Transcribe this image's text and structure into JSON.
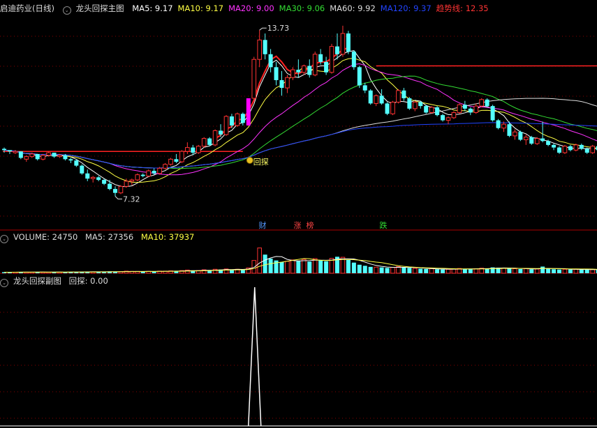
{
  "main_header": {
    "stock": "启迪药业(日线)",
    "indicator": "龙头回探主图",
    "items": [
      {
        "label": "MA5: 9.17",
        "color": "#ffffff"
      },
      {
        "label": "MA10: 9.17",
        "color": "#ffff44"
      },
      {
        "label": "MA20: 9.00",
        "color": "#ff33ff"
      },
      {
        "label": "MA30: 9.06",
        "color": "#33dd33"
      },
      {
        "label": "MA60: 9.92",
        "color": "#dddddd"
      },
      {
        "label": "MA120: 9.37",
        "color": "#2244ff"
      },
      {
        "label": "趋势线: 12.35",
        "color": "#ff3333"
      }
    ]
  },
  "volume_header": {
    "title": "VOLUME: 24750",
    "ma5": "MA5: 27356",
    "ma10": "MA10: 37937"
  },
  "sub_header": {
    "title": "龙头回探副图",
    "value": "回探: 0.00"
  },
  "annotations": {
    "high": "13.73",
    "low": "7.32",
    "signal": "回探",
    "tags": [
      {
        "text": "财",
        "color": "#5599ff"
      },
      {
        "text": "涨",
        "color": "#ff4444"
      },
      {
        "text": "榜",
        "color": "#ff4444"
      },
      {
        "text": "跌",
        "color": "#33dd33"
      }
    ]
  },
  "colors": {
    "up": "#ff3333",
    "down": "#54ffff",
    "volume_up": "#ff3333",
    "volume_down": "#54ffff",
    "grid": "#8a0000",
    "divider": "#aa0000",
    "limit_up_bar": "#ff00ff",
    "trend_line": "#ff2222"
  },
  "chart_data": {
    "type": "candlestick",
    "price_range": [
      6.5,
      14.3
    ],
    "trend_levels": [
      9.05,
      12.35
    ],
    "candles": [
      [
        9.15,
        9.2,
        9.0,
        9.1
      ],
      [
        9.1,
        9.1,
        8.95,
        9.05
      ],
      [
        9.0,
        9.1,
        8.95,
        9.05
      ],
      [
        9.05,
        9.05,
        8.75,
        8.8
      ],
      [
        8.75,
        8.9,
        8.65,
        8.85
      ],
      [
        8.85,
        9.0,
        8.8,
        8.95
      ],
      [
        8.95,
        8.95,
        8.7,
        8.75
      ],
      [
        8.75,
        8.95,
        8.7,
        8.9
      ],
      [
        8.9,
        9.05,
        8.85,
        9.0
      ],
      [
        9.0,
        9.0,
        8.8,
        8.85
      ],
      [
        8.85,
        8.95,
        8.8,
        8.9
      ],
      [
        8.9,
        8.95,
        8.7,
        8.75
      ],
      [
        8.75,
        8.8,
        8.6,
        8.7
      ],
      [
        8.7,
        8.75,
        8.45,
        8.5
      ],
      [
        8.5,
        8.55,
        8.15,
        8.2
      ],
      [
        8.2,
        8.35,
        7.9,
        8.0
      ],
      [
        8.0,
        8.1,
        7.85,
        8.05
      ],
      [
        8.05,
        8.1,
        7.9,
        7.95
      ],
      [
        7.95,
        8.0,
        7.75,
        7.8
      ],
      [
        7.8,
        7.95,
        7.55,
        7.6
      ],
      [
        7.6,
        7.7,
        7.32,
        7.45
      ],
      [
        7.45,
        7.75,
        7.4,
        7.7
      ],
      [
        7.7,
        8.0,
        7.65,
        7.9
      ],
      [
        7.9,
        8.0,
        7.75,
        7.95
      ],
      [
        7.95,
        8.2,
        7.9,
        8.15
      ],
      [
        8.15,
        8.2,
        8.05,
        8.1
      ],
      [
        8.1,
        8.35,
        8.05,
        8.3
      ],
      [
        8.3,
        8.4,
        8.15,
        8.2
      ],
      [
        8.2,
        8.45,
        8.15,
        8.4
      ],
      [
        8.4,
        8.6,
        8.35,
        8.55
      ],
      [
        8.55,
        8.8,
        8.5,
        8.75
      ],
      [
        8.75,
        8.95,
        8.6,
        8.65
      ],
      [
        8.65,
        9.1,
        8.6,
        9.05
      ],
      [
        9.05,
        9.4,
        8.95,
        9.2
      ],
      [
        9.2,
        9.3,
        8.9,
        9.0
      ],
      [
        9.0,
        9.3,
        8.95,
        9.25
      ],
      [
        9.25,
        9.6,
        9.2,
        9.55
      ],
      [
        9.55,
        9.6,
        9.25,
        9.3
      ],
      [
        9.3,
        9.9,
        9.25,
        9.85
      ],
      [
        9.85,
        10.1,
        9.6,
        9.7
      ],
      [
        9.7,
        10.45,
        9.65,
        10.4
      ],
      [
        10.4,
        10.5,
        9.95,
        10.05
      ],
      [
        10.05,
        10.55,
        10.0,
        10.5
      ],
      [
        10.5,
        10.55,
        10.05,
        10.15
      ],
      [
        10.05,
        11.1,
        10.05,
        11.1
      ],
      [
        11.1,
        12.7,
        11.0,
        12.6
      ],
      [
        12.6,
        13.73,
        12.3,
        13.35
      ],
      [
        13.35,
        13.6,
        12.6,
        12.8
      ],
      [
        12.8,
        13.0,
        12.1,
        12.3
      ],
      [
        12.3,
        12.5,
        11.6,
        11.8
      ],
      [
        11.8,
        12.15,
        11.2,
        11.5
      ],
      [
        11.5,
        12.0,
        11.3,
        11.9
      ],
      [
        11.9,
        12.3,
        11.8,
        12.2
      ],
      [
        12.2,
        12.6,
        11.9,
        12.1
      ],
      [
        12.1,
        12.4,
        12.0,
        12.35
      ],
      [
        12.35,
        12.6,
        11.9,
        12.0
      ],
      [
        12.0,
        12.9,
        11.95,
        12.8
      ],
      [
        12.8,
        13.0,
        12.4,
        12.5
      ],
      [
        12.5,
        12.7,
        12.0,
        12.1
      ],
      [
        12.1,
        13.2,
        12.05,
        13.1
      ],
      [
        13.1,
        13.6,
        12.6,
        12.8
      ],
      [
        12.8,
        13.9,
        12.7,
        13.6
      ],
      [
        13.6,
        13.7,
        12.8,
        12.9
      ],
      [
        12.9,
        12.95,
        12.2,
        12.3
      ],
      [
        12.3,
        12.35,
        11.5,
        11.6
      ],
      [
        11.6,
        11.7,
        11.3,
        11.4
      ],
      [
        11.4,
        11.45,
        10.85,
        10.9
      ],
      [
        10.9,
        11.25,
        10.8,
        11.2
      ],
      [
        11.2,
        11.45,
        10.85,
        10.9
      ],
      [
        10.9,
        10.95,
        10.45,
        10.5
      ],
      [
        10.5,
        11.0,
        10.45,
        10.95
      ],
      [
        10.95,
        11.45,
        10.9,
        11.4
      ],
      [
        11.4,
        11.5,
        11.0,
        11.1
      ],
      [
        11.1,
        11.15,
        10.65,
        10.7
      ],
      [
        10.7,
        11.0,
        10.6,
        10.95
      ],
      [
        10.95,
        11.0,
        10.7,
        10.8
      ],
      [
        10.8,
        10.85,
        10.5,
        10.55
      ],
      [
        10.55,
        10.8,
        10.5,
        10.75
      ],
      [
        10.75,
        10.8,
        10.4,
        10.45
      ],
      [
        10.45,
        10.5,
        10.2,
        10.25
      ],
      [
        10.25,
        10.4,
        10.1,
        10.35
      ],
      [
        10.35,
        10.6,
        10.3,
        10.55
      ],
      [
        10.55,
        10.9,
        10.5,
        10.85
      ],
      [
        10.85,
        11.0,
        10.6,
        10.7
      ],
      [
        10.7,
        10.75,
        10.45,
        10.55
      ],
      [
        10.55,
        10.9,
        10.5,
        10.8
      ],
      [
        10.8,
        11.1,
        10.75,
        11.05
      ],
      [
        11.05,
        11.1,
        10.75,
        10.8
      ],
      [
        10.8,
        10.85,
        10.2,
        10.25
      ],
      [
        10.25,
        10.3,
        9.9,
        9.95
      ],
      [
        9.95,
        10.2,
        9.8,
        10.1
      ],
      [
        10.1,
        10.2,
        9.6,
        9.65
      ],
      [
        9.65,
        9.9,
        9.5,
        9.8
      ],
      [
        9.8,
        9.85,
        9.45,
        9.5
      ],
      [
        9.5,
        9.7,
        9.3,
        9.6
      ],
      [
        9.6,
        9.65,
        9.3,
        9.35
      ],
      [
        9.35,
        9.6,
        9.3,
        9.55
      ],
      [
        9.55,
        10.2,
        9.4,
        9.45
      ],
      [
        9.45,
        9.5,
        9.25,
        9.3
      ],
      [
        9.3,
        9.35,
        9.1,
        9.2
      ],
      [
        9.2,
        9.25,
        8.95,
        9.0
      ],
      [
        9.0,
        9.3,
        8.95,
        9.25
      ],
      [
        9.25,
        9.3,
        9.05,
        9.1
      ],
      [
        9.1,
        9.35,
        9.05,
        9.3
      ],
      [
        9.3,
        9.35,
        9.1,
        9.15
      ],
      [
        9.15,
        9.2,
        8.95,
        9.0
      ],
      [
        9.0,
        9.3,
        8.95,
        9.25
      ],
      [
        9.25,
        9.35,
        9.05,
        9.1
      ]
    ],
    "volume_range": [
      0,
      220000
    ],
    "volume": [
      4,
      4,
      4,
      5,
      4,
      4,
      5,
      4,
      4,
      5,
      4,
      4,
      5,
      5,
      6,
      6,
      5,
      5,
      6,
      7,
      6,
      6,
      8,
      7,
      7,
      6,
      7,
      7,
      8,
      8,
      9,
      8,
      10,
      12,
      9,
      10,
      13,
      11,
      15,
      14,
      16,
      13,
      15,
      14,
      20,
      48,
      95,
      70,
      55,
      48,
      42,
      45,
      50,
      47,
      52,
      44,
      55,
      48,
      45,
      56,
      62,
      60,
      50,
      40,
      32,
      28,
      24,
      23,
      22,
      20,
      22,
      25,
      22,
      20,
      18,
      17,
      16,
      17,
      15,
      14,
      15,
      16,
      18,
      17,
      16,
      17,
      19,
      18,
      22,
      21,
      19,
      18,
      17,
      16,
      17,
      15,
      16,
      25,
      18,
      15,
      14,
      15,
      14,
      15,
      14,
      13,
      14,
      13
    ],
    "signal": {
      "index": 45,
      "value": 1.0,
      "range": [
        0,
        1.0
      ]
    }
  }
}
